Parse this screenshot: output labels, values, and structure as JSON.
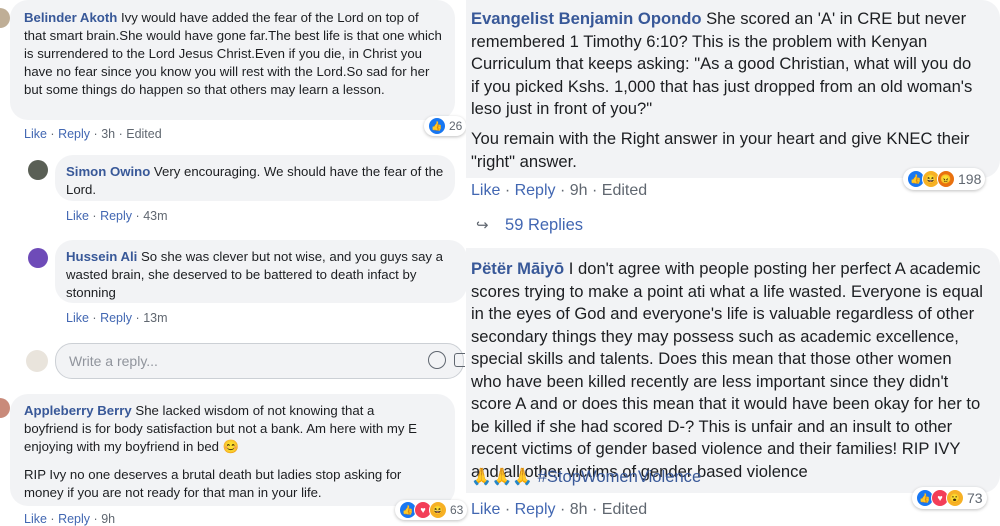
{
  "left": {
    "c1": {
      "name": "Belinder Akoth",
      "text": " Ivy would have added the fear of the Lord on top of that smart brain.She would have gone far.The best life is that one which is surrendered to the Lord Jesus Christ.Even if you die, in Christ you have no fear since you know you will rest with the Lord.So sad for her but some things do happen so that others may learn a lesson.",
      "like": "Like",
      "reply": "Reply",
      "time": "3h",
      "edited": "Edited",
      "count": "26"
    },
    "c2": {
      "name": "Simon Owino",
      "text": " Very encouraging. We should have the fear of the Lord.",
      "like": "Like",
      "reply": "Reply",
      "time": "43m"
    },
    "c3": {
      "name": "Hussein Ali",
      "text": " So she was clever but not wise, and you guys say a wasted brain, she deserved to be battered to death infact by stonning",
      "like": "Like",
      "reply": "Reply",
      "time": "13m"
    },
    "write_placeholder": "Write a reply...",
    "c4": {
      "name": "Appleberry Berry",
      "text": " She lacked wisdom of not knowing that a boyfriend is for body satisfaction but not a bank. Am here with my E enjoying with my boyfriend in bed 😊",
      "text2": "RIP Ivy no one deserves a brutal death but ladies stop asking for money if you are not ready for that man in your life.",
      "like": "Like",
      "reply": "Reply",
      "time": "9h",
      "count": "63"
    }
  },
  "right": {
    "c1": {
      "name": "Evangelist Benjamin Opondo",
      "text": " She scored an 'A' in CRE but never remembered 1 Timothy 6:10? This is the problem with Kenyan Curriculum that keeps asking: \"As a good Christian, what will you do if you picked Kshs. 1,000 that has just dropped from an old woman's leso just in front of you?\"",
      "text2": "You remain with the Right answer in your heart and give KNEC their \"right\" answer.",
      "like": "Like",
      "reply": "Reply",
      "time": "9h",
      "edited": "Edited",
      "count": "198"
    },
    "replies": "59 Replies",
    "c2": {
      "name": "Pëtër Māiyō",
      "text": " I don't agree with people posting her perfect A academic scores trying to make a point ati what a life wasted. Everyone is equal in the eyes of God and everyone's life is valuable regardless of other secondary things they may possess such as academic excellence, special skills and talents. Does this mean that those other women who have been killed recently are less important since they didn't score A and or does this mean that it would have been okay for her to be killed if she had scored D-? This is unfair and an insult to other recent victims of gender based violence and their families! RIP IVY and all other victims of gender based violence",
      "hashtag": "#StopWomenViolence",
      "emojis": "🙏🙏🙏",
      "like": "Like",
      "reply": "Reply",
      "time": "8h",
      "edited": "Edited",
      "count": "73"
    }
  },
  "colors": {
    "link": "#385898",
    "action": "#4267b2",
    "bubble": "#f2f3f5"
  }
}
